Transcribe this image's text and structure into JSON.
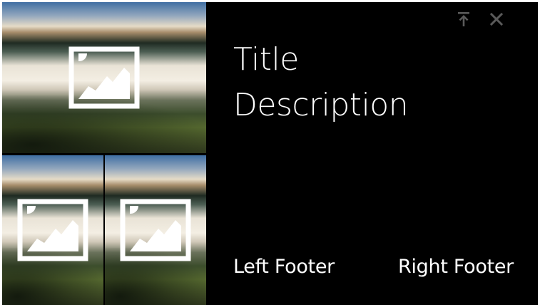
{
  "card": {
    "title": "Title",
    "description": "Description",
    "footer_left": "Left Footer",
    "footer_right": "Right Footer"
  },
  "toolbar": {
    "pin_icon": "pin-to-top-icon",
    "close_icon": "close-icon"
  },
  "mosaic": {
    "tiles": [
      {
        "icon": "image-placeholder-icon"
      },
      {
        "icon": "image-placeholder-icon"
      },
      {
        "icon": "image-placeholder-icon"
      }
    ]
  },
  "colors": {
    "card_background": "#000000",
    "text": "#ffffff",
    "toolbar_icon": "#5a5a5a"
  }
}
